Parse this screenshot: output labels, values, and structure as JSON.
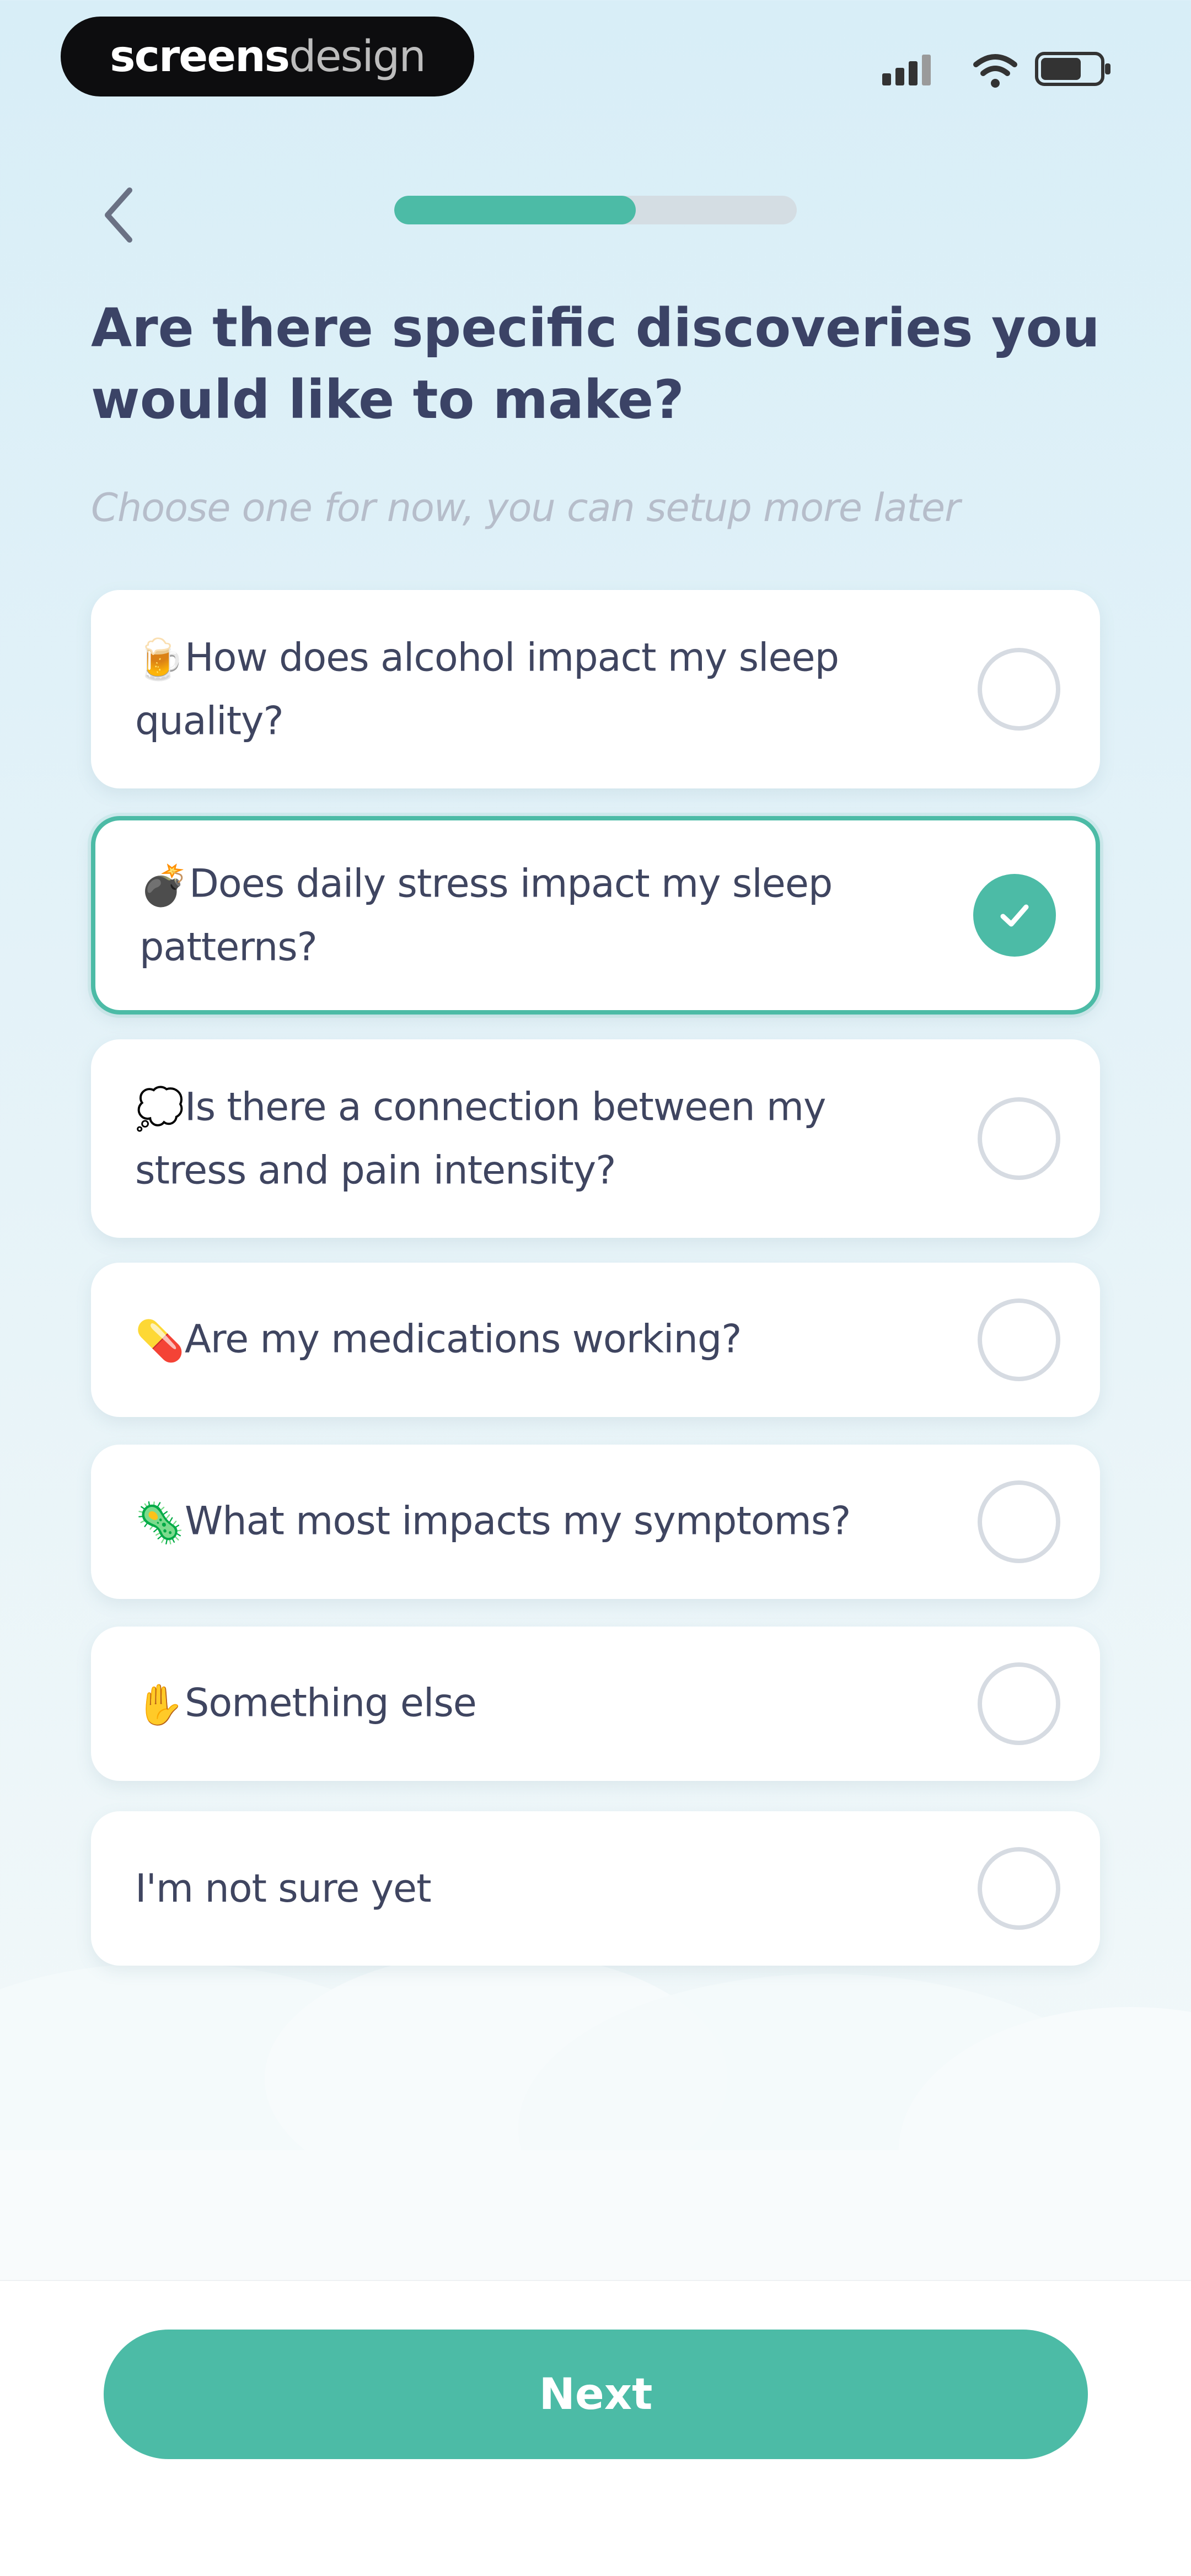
{
  "status_bar": {
    "brand_strong": "screens",
    "brand_light": "design",
    "icons": [
      "signal-icon",
      "wifi-icon",
      "battery-icon"
    ]
  },
  "header": {
    "back_icon": "chevron-left-icon",
    "progress": 0.6
  },
  "title": "Are there specific discoveries you would like to make?",
  "subtitle": "Choose one for now, you can setup more later",
  "options": [
    {
      "emoji": "🍺",
      "label": "How does alcohol impact my sleep quality?",
      "selected": false
    },
    {
      "emoji": "💣",
      "label": "Does daily stress impact my sleep patterns?",
      "selected": true
    },
    {
      "emoji": "💭",
      "label": "Is there a connection between my stress and pain intensity?",
      "selected": false
    },
    {
      "emoji": "💊",
      "label": "Are my medications working?",
      "selected": false
    },
    {
      "emoji": "🦠",
      "label": "What most impacts my symptoms?",
      "selected": false
    },
    {
      "emoji": "✋",
      "label": "Something else",
      "selected": false
    },
    {
      "emoji": "",
      "label": "I'm not sure yet",
      "selected": false
    }
  ],
  "next_button": "Next",
  "colors": {
    "accent": "#4cbba6",
    "title": "#3b4366",
    "subtitle": "#b6bdca",
    "card": "#ffffff"
  }
}
